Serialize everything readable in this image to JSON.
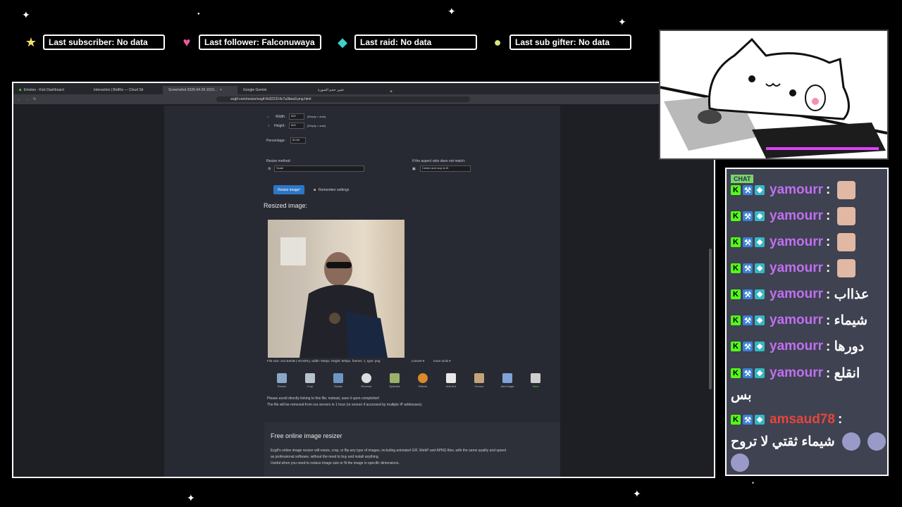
{
  "alerts": {
    "subscriber": "Last subscriber: No data",
    "follower": "Last follower: Falconuwaya",
    "raid": "Last raid: No data",
    "sub_gifter": "Last sub gifter: No data",
    "icons": [
      "star-icon",
      "heart-icon",
      "gem-icon",
      "coin-icon"
    ],
    "icon_colors": [
      "#f5e06a",
      "#e85aa0",
      "#3fd0c9",
      "#d9e87a"
    ]
  },
  "browser": {
    "tabs": [
      "Emotes - Kick Dashboard",
      "Interaction | BotRix — Cloud Str",
      "Screenshot 2026-04-26 1010...",
      "Google Gemini",
      "تغيير حجم الصورة"
    ],
    "url": "ezgif.com/resize/ezgif-8c822314c7a3bea9.png.html"
  },
  "ezgif": {
    "width_label": "Width:",
    "width_value": "500",
    "width_hint": "(Empty = auto)",
    "height_label": "Height:",
    "height_value": "500",
    "height_hint": "(Empty = auto)",
    "percentage_label": "Percentage:",
    "percentage_value": "52.89",
    "method_label": "Resize method:",
    "method_value": "Scale",
    "aspect_label": "If the aspect ratio does not match:",
    "aspect_value": "Center and crop to fit",
    "resize_button": "Resize image!",
    "remember_label": "Remember settings",
    "resized_title": "Resized image:",
    "file_info": "File size: 210.54KiB (-40.83%), width: 500px, height: 500px, frames: 1, type: png",
    "convert": "convert ▾",
    "more_tools": "more tools ▾",
    "tools": [
      "Resize",
      "Crop",
      "Rotate",
      "Reverse",
      "Optimize",
      "Effects",
      "Add text",
      "Censor",
      "Add image",
      "Save"
    ],
    "notice1": "Please avoid directly linking to this file; instead, save it upon completion!",
    "notice2": "The file will be removed from our servers in 1 hour (or sooner if accessed by multiple IP addresses).",
    "section_title": "Free online image resizer",
    "section_text1": "Ezgif's online image resizer will resize, crop, or flip any type of images, including animated GIF, WebP and APNG files, with the same quality and speed",
    "section_text2": "as professional software, without the need to buy and install anything.",
    "section_text3": "Useful when you need to reduce image size or fit the image in specific dimensions."
  },
  "chat": {
    "header": "CHAT",
    "messages": [
      {
        "user": "yamourr",
        "text": ":",
        "emote": true
      },
      {
        "user": "yamourr",
        "text": ":",
        "emote": true
      },
      {
        "user": "yamourr",
        "text": ":",
        "emote": true
      },
      {
        "user": "yamourr",
        "text": ":",
        "emote": true
      },
      {
        "user": "yamourr",
        "text": ": عذااب",
        "emote": false
      },
      {
        "user": "yamourr",
        "text": ": شيماء",
        "emote": false
      },
      {
        "user": "yamourr",
        "text": ": دورها",
        "emote": false
      },
      {
        "user": "yamourr",
        "text": ": انقلع",
        "emote": false
      }
    ],
    "continuation": "بس",
    "last_user": "amsaud78",
    "last_colon": ":",
    "last_text": "شيماء ثقتي لا تروح"
  }
}
